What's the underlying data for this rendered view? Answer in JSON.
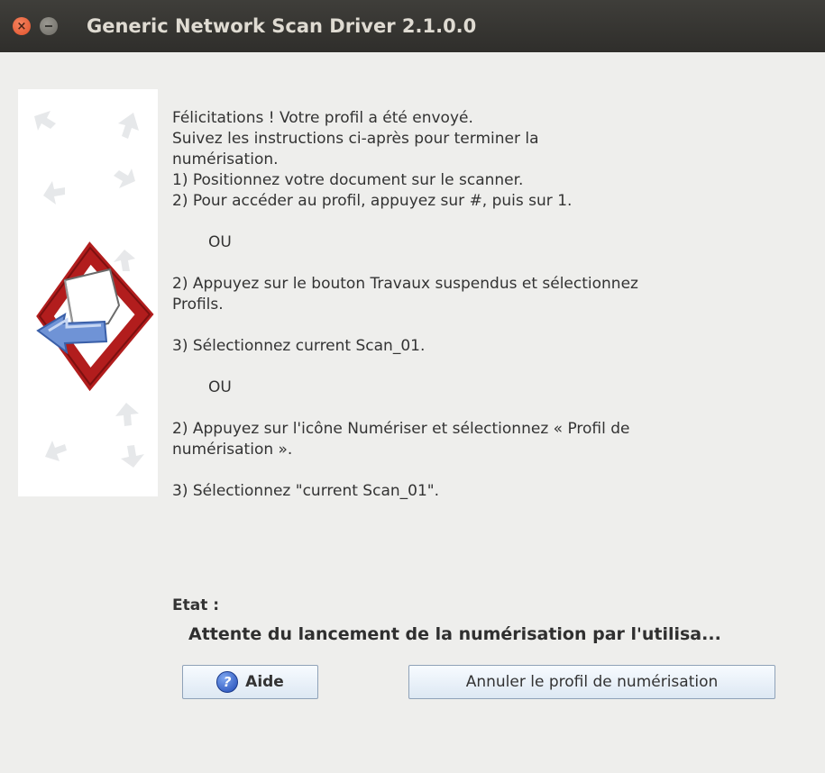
{
  "window": {
    "title": "Generic Network Scan Driver 2.1.0.0",
    "close_glyph": "×"
  },
  "instructions": [
    "Félicitations ! Votre profil a été envoyé.",
    "Suivez les instructions ci-après pour terminer la",
    "numérisation.",
    "1) Positionnez votre document sur le scanner.",
    "2) Pour accéder au profil, appuyez sur #, puis sur 1.",
    "",
    "OU",
    "",
    "2) Appuyez sur le bouton Travaux suspendus et sélectionnez",
    "Profils.",
    "",
    "3) Sélectionnez current Scan_01.",
    "",
    "OU",
    "",
    "2) Appuyez sur l'icône Numériser et sélectionnez « Profil de",
    "numérisation ».",
    "",
    "3) Sélectionnez \"current Scan_01\"."
  ],
  "status": {
    "label": "Etat :",
    "text": "Attente du lancement de la numérisation par l'utilisa..."
  },
  "buttons": {
    "help_label": "Aide",
    "help_icon_glyph": "?",
    "cancel_label": "Annuler le profil de numérisation"
  },
  "icons": {
    "close": "close-icon",
    "minimize": "minimize-icon",
    "help": "help-icon",
    "scan_illustration": "scan-document-icon"
  },
  "colors": {
    "titlebar": "#3a3935",
    "close_button": "#e9643b",
    "button_border": "#8fa2b8",
    "background": "#eeeeec"
  }
}
